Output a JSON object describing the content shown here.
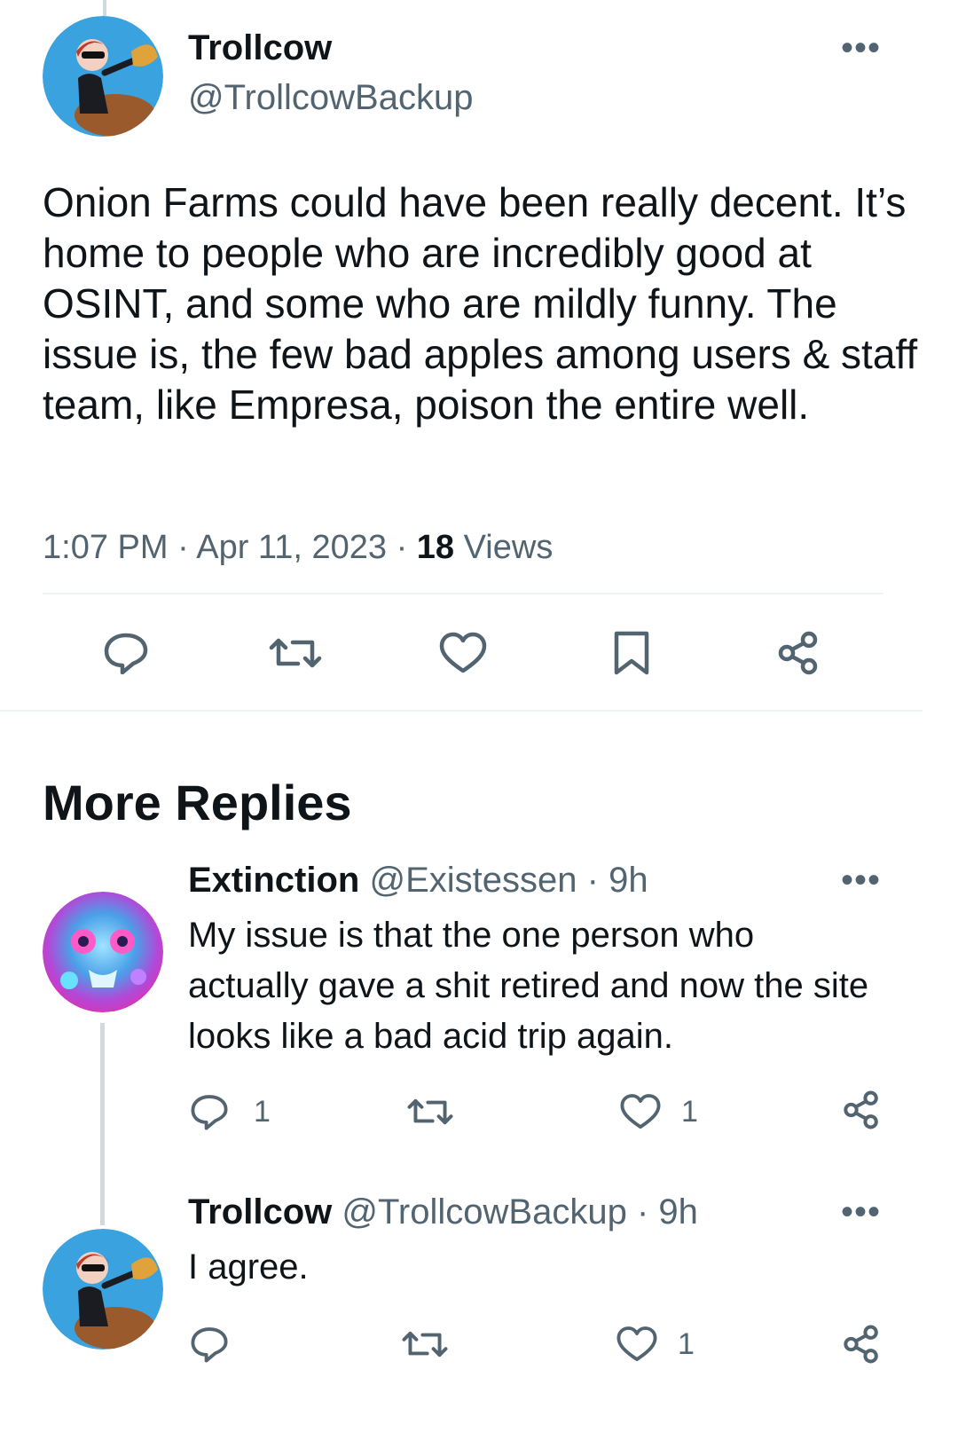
{
  "main_tweet": {
    "name": "Trollcow",
    "handle": "@TrollcowBackup",
    "text": "Onion Farms could have been really decent. It’s home to people who are incredibly good at OSINT, and some who are mildly funny. The issue is, the few bad apples among users & staff team, like Empresa, poison the entire well.",
    "time": "1:07 PM",
    "date": "Apr 11, 2023",
    "views_count": "18",
    "views_label": "Views",
    "more_icon": "more-horizontal-icon"
  },
  "section": {
    "title": "More Replies"
  },
  "replies": [
    {
      "name": "Extinction",
      "handle": "@Existessen",
      "time": "9h",
      "text": "My issue is that the one person who actually gave a shit retired and now the site looks like a bad acid trip again.",
      "reply_count": "1",
      "like_count": "1"
    },
    {
      "name": "Trollcow",
      "handle": "@TrollcowBackup",
      "time": "9h",
      "text": "I agree.",
      "like_count": "1"
    }
  ],
  "separator": "·",
  "colors": {
    "text": "#0f1419",
    "secondary": "#536471",
    "divider": "#eff3f4",
    "avatar_bg": "#36a6e3"
  }
}
